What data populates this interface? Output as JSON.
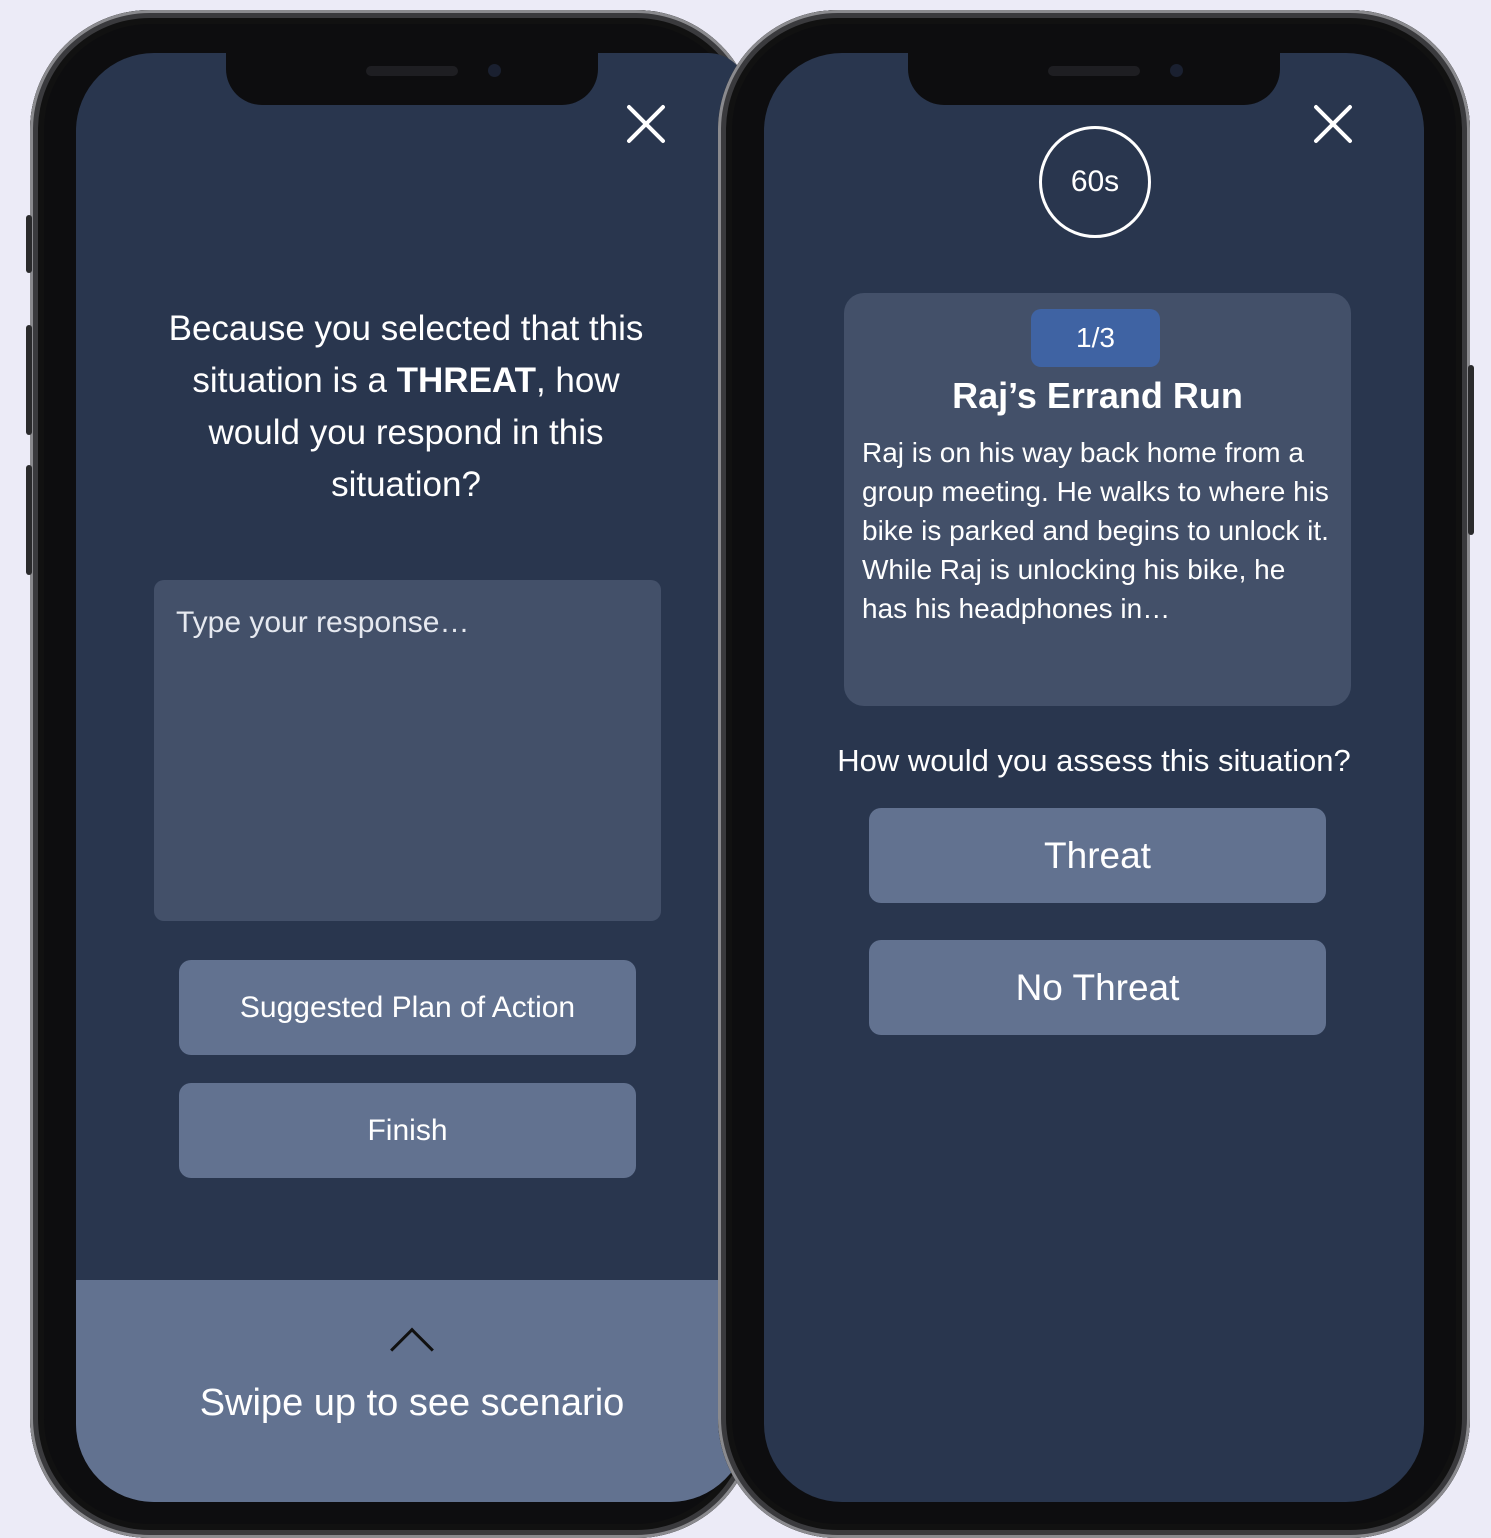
{
  "left_screen": {
    "prompt_before": "Because you selected that this situation is a ",
    "prompt_emphasis": "THREAT",
    "prompt_after": ", how would you respond in this situation?",
    "response_placeholder": "Type your response…",
    "buttons": {
      "suggested_plan": "Suggested Plan of Action",
      "finish": "Finish"
    },
    "swipe_text": "Swipe up to see scenario",
    "icons": {
      "close": "close-icon",
      "swipe": "chevron-up-icon"
    }
  },
  "right_screen": {
    "timer": "60s",
    "scenario": {
      "progress": "1/3",
      "title": "Raj’s Errand Run",
      "body": "Raj is on his way back home from a group meeting. He walks to where his bike is parked and begins to unlock it. While Raj is unlocking his bike, he has his headphones in…"
    },
    "question": "How would you assess this situation?",
    "choices": [
      "Threat",
      "No Threat"
    ],
    "icons": {
      "close": "close-icon"
    }
  },
  "colors": {
    "background": "#ecebf7",
    "screen": "#29364e",
    "card": "#435069",
    "button": "#627290",
    "badge": "#3f63a3"
  }
}
